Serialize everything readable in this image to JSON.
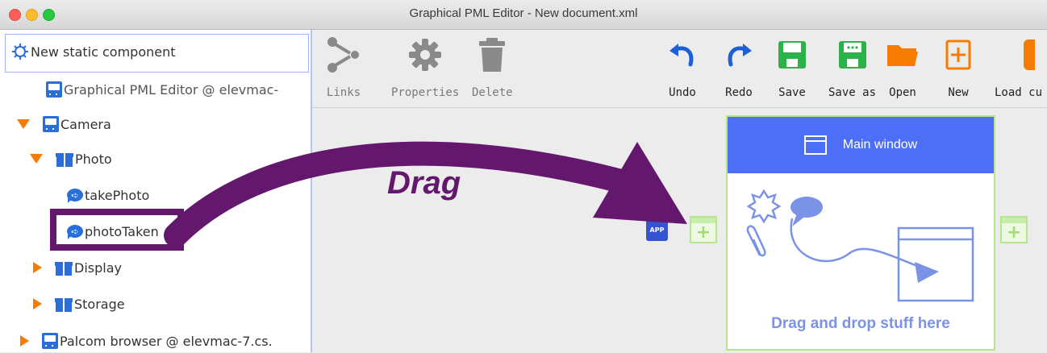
{
  "window": {
    "title": "Graphical PML Editor - New document.xml"
  },
  "tree": {
    "root_label": "New static component",
    "items": [
      {
        "label": "Graphical PML Editor @ elevmac-"
      },
      {
        "label": "Camera"
      },
      {
        "label": "Photo"
      },
      {
        "label": "takePhoto"
      },
      {
        "label": "photoTaken"
      },
      {
        "label": "Display"
      },
      {
        "label": "Storage"
      },
      {
        "label": "Palcom browser @ elevmac-7.cs."
      }
    ]
  },
  "toolbar": {
    "links": "Links",
    "properties": "Properties",
    "delete": "Delete",
    "undo": "Undo",
    "redo": "Redo",
    "save": "Save",
    "save_as": "Save as",
    "open": "Open",
    "new": "New",
    "load": "Load cu"
  },
  "canvas": {
    "app_badge": "APP",
    "main_window_title": "Main window",
    "drop_hint": "Drag and drop stuff here"
  },
  "annotation": {
    "drag_label": "Drag"
  },
  "colors": {
    "accent": "#4d6ff5",
    "annotation": "#63186d",
    "tree_icon": "#2a6fd8",
    "expander": "#f57c00",
    "save_green": "#2bb34a"
  }
}
